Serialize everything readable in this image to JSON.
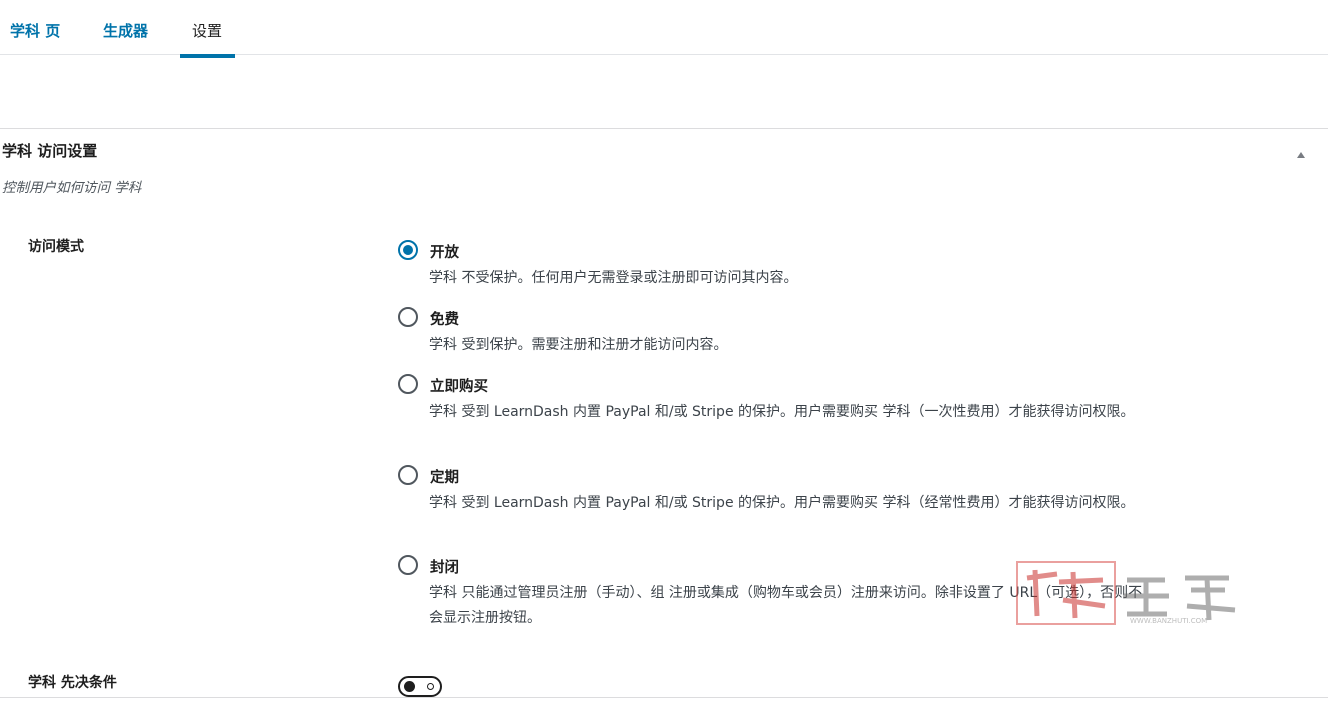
{
  "tabs": [
    {
      "label": "学科 页"
    },
    {
      "label": "生成器"
    },
    {
      "label": "设置"
    }
  ],
  "panel": {
    "title": "学科 访问设置",
    "description": "控制用户如何访问 学科"
  },
  "access_mode": {
    "label": "访问模式",
    "selected": "开放",
    "options": [
      {
        "label": "开放",
        "desc": "学科 不受保护。任何用户无需登录或注册即可访问其内容。"
      },
      {
        "label": "免费",
        "desc": "学科 受到保护。需要注册和注册才能访问内容。"
      },
      {
        "label": "立即购买",
        "desc": "学科 受到 LearnDash 内置 PayPal 和/或 Stripe 的保护。用户需要购买 学科（一次性费用）才能获得访问权限。"
      },
      {
        "label": "定期",
        "desc": "学科 受到 LearnDash 内置 PayPal 和/或 Stripe 的保护。用户需要购买 学科（经常性费用）才能获得访问权限。"
      },
      {
        "label": "封闭",
        "desc": "学科 只能通过管理员注册（手动）、组 注册或集成（购物车或会员）注册来访问。除非设置了 URL（可选），否则不会显示注册按钮。"
      }
    ]
  },
  "prerequisites": {
    "label": "学科 先决条件",
    "enabled": false
  },
  "watermark": {
    "text": "WWW.BANZHUTI.COM"
  },
  "colors": {
    "accent": "#0073aa",
    "text": "#1e1e1e",
    "muted": "#50575e"
  }
}
